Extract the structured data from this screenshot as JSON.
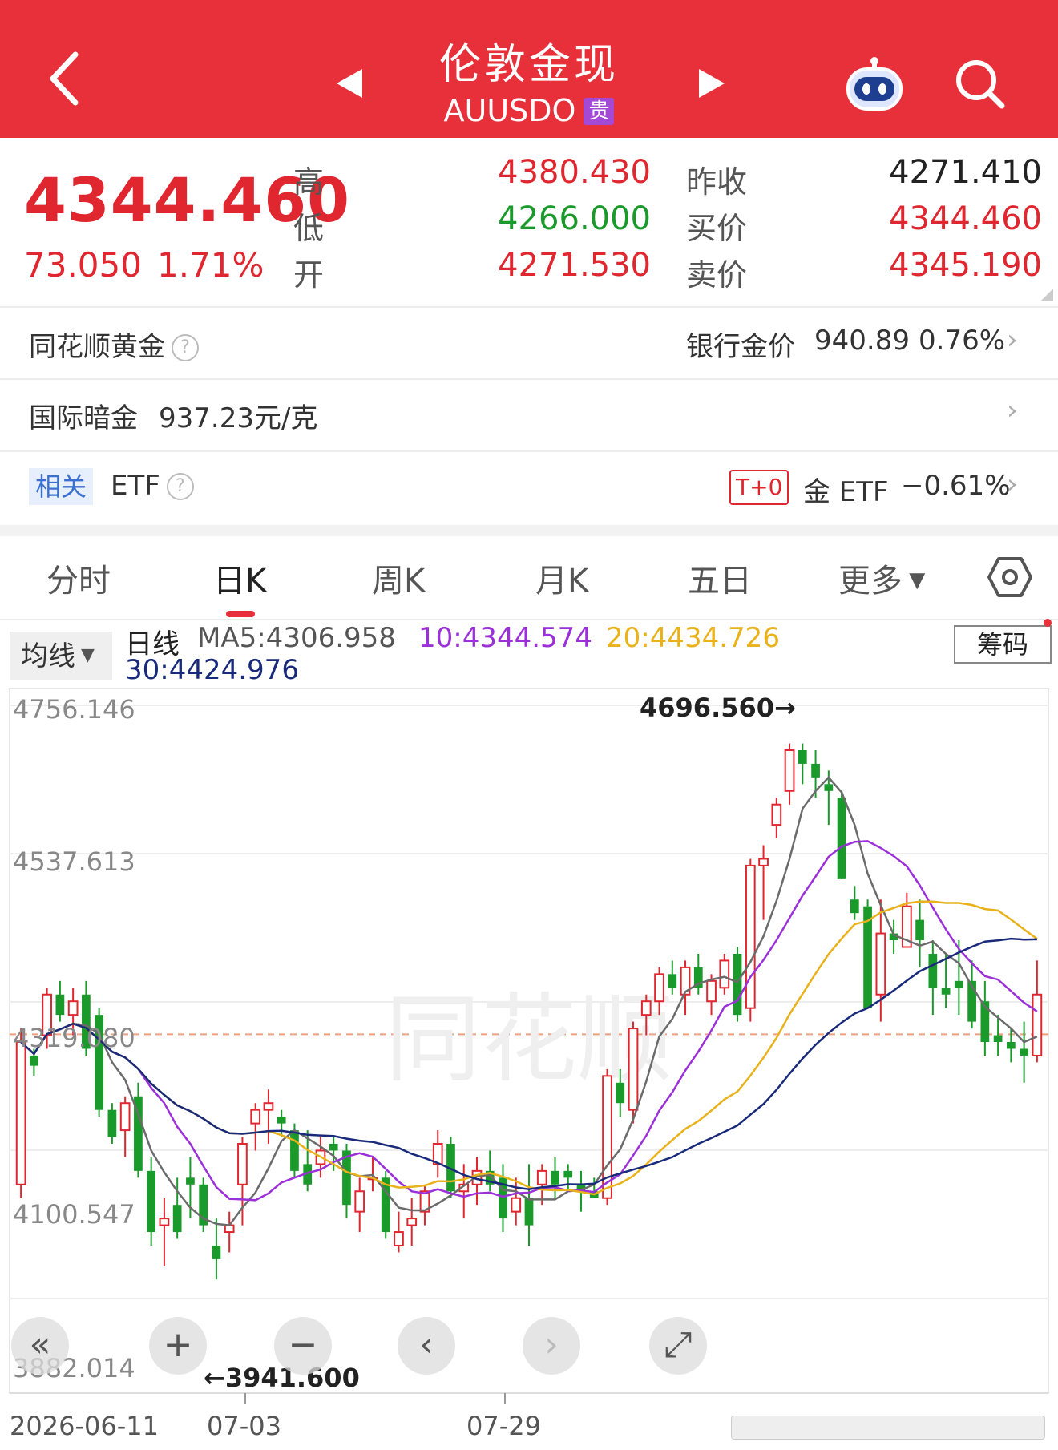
{
  "header": {
    "title": "伦敦金现",
    "subtitle": "AUUSDO",
    "badge": "贵"
  },
  "quote": {
    "price": "4344.460",
    "change": "73.050",
    "change_pct": "1.71%",
    "high_label": "高",
    "high": "4380.430",
    "low_label": "低",
    "low": "4266.000",
    "open_label": "开",
    "open": "4271.530",
    "prev_close_label": "昨收",
    "prev_close": "4271.410",
    "bid_label": "买价",
    "bid": "4344.460",
    "ask_label": "卖价",
    "ask": "4345.190"
  },
  "rows": {
    "ths_gold": "同花顺黄金",
    "bank_gold_label": "银行金价",
    "bank_gold_price": "940.89",
    "bank_gold_pct": "0.76%",
    "dark_gold_label": "国际暗金",
    "dark_gold_value": "937.23元/克",
    "related_tag": "相关",
    "etf_label": "ETF",
    "t0_tag": "T+0",
    "gold_etf_label": "金 ETF",
    "gold_etf_pct": "−0.61%"
  },
  "tabs": [
    "分时",
    "日K",
    "周K",
    "月K",
    "五日",
    "更多"
  ],
  "indicators": {
    "dropdown": "均线",
    "period": "日线",
    "ma5": "MA5:4306.958",
    "ma10": "10:4344.574",
    "ma20": "20:4434.726",
    "ma30": "30:4424.976",
    "chip_button": "筹码"
  },
  "colors": {
    "header": "#e8303a",
    "up": "#e0262f",
    "down": "#1a9a2a",
    "ma5": "#6b6b6b",
    "ma10": "#9b30d9",
    "ma20": "#e9b21a",
    "ma30": "#1a2a7a"
  },
  "icons": [
    "back-icon",
    "prev-arrow-icon",
    "next-arrow-icon",
    "robot-icon",
    "search-icon",
    "help-icon",
    "chevron-right-icon",
    "settings-hexagon-icon"
  ],
  "chart_data": {
    "type": "candlestick",
    "y_ticks": [
      "4756.146",
      "4537.613",
      "4319.080",
      "4100.547",
      "3882.014"
    ],
    "ylim": [
      3882.014,
      4756.146
    ],
    "x_ticks": [
      "2026-06-11",
      "07-03",
      "07-29"
    ],
    "max_label": "4696.560→",
    "min_label": "←3941.600",
    "ref_line": 4271.41,
    "candles": [
      [
        4050,
        4280,
        4030,
        4260
      ],
      [
        4240,
        4250,
        4210,
        4225
      ],
      [
        4270,
        4340,
        4250,
        4330
      ],
      [
        4330,
        4350,
        4290,
        4300
      ],
      [
        4300,
        4340,
        4270,
        4320
      ],
      [
        4330,
        4350,
        4240,
        4250
      ],
      [
        4300,
        4310,
        4150,
        4160
      ],
      [
        4160,
        4170,
        4110,
        4120
      ],
      [
        4130,
        4180,
        4090,
        4170
      ],
      [
        4180,
        4200,
        4060,
        4070
      ],
      [
        4070,
        4090,
        3960,
        3980
      ],
      [
        3990,
        4030,
        3930,
        4000
      ],
      [
        4020,
        4060,
        3970,
        3980
      ],
      [
        4060,
        4090,
        4000,
        4050
      ],
      [
        4050,
        4060,
        3980,
        3990
      ],
      [
        3960,
        4000,
        3910,
        3940
      ],
      [
        3980,
        4010,
        3950,
        3990
      ],
      [
        4050,
        4120,
        3990,
        4110
      ],
      [
        4140,
        4170,
        4100,
        4160
      ],
      [
        4160,
        4190,
        4110,
        4170
      ],
      [
        4150,
        4160,
        4120,
        4140
      ],
      [
        4130,
        4140,
        4060,
        4070
      ],
      [
        4080,
        4130,
        4040,
        4050
      ],
      [
        4080,
        4120,
        4060,
        4100
      ],
      [
        4110,
        4120,
        4070,
        4100
      ],
      [
        4100,
        4110,
        4000,
        4020
      ],
      [
        4010,
        4060,
        3980,
        4040
      ],
      [
        4060,
        4090,
        4040,
        4060
      ],
      [
        4060,
        4070,
        3970,
        3980
      ],
      [
        3960,
        4010,
        3950,
        3980
      ],
      [
        3990,
        4030,
        3960,
        4000
      ],
      [
        4010,
        4050,
        3990,
        4040
      ],
      [
        4080,
        4130,
        4060,
        4110
      ],
      [
        4110,
        4120,
        4030,
        4040
      ],
      [
        4040,
        4080,
        4000,
        4050
      ],
      [
        4050,
        4090,
        4020,
        4070
      ],
      [
        4070,
        4100,
        4040,
        4050
      ],
      [
        4060,
        4080,
        3980,
        4000
      ],
      [
        4010,
        4060,
        3990,
        4030
      ],
      [
        4030,
        4080,
        3960,
        3990
      ],
      [
        4050,
        4080,
        4020,
        4070
      ],
      [
        4070,
        4090,
        4030,
        4050
      ],
      [
        4070,
        4080,
        4040,
        4060
      ],
      [
        4050,
        4070,
        4010,
        4040
      ],
      [
        4040,
        4060,
        4030,
        4030
      ],
      [
        4030,
        4220,
        4020,
        4210
      ],
      [
        4200,
        4220,
        4150,
        4170
      ],
      [
        4160,
        4290,
        4140,
        4280
      ],
      [
        4300,
        4330,
        4270,
        4320
      ],
      [
        4320,
        4370,
        4300,
        4360
      ],
      [
        4360,
        4380,
        4330,
        4340
      ],
      [
        4330,
        4380,
        4300,
        4370
      ],
      [
        4370,
        4390,
        4330,
        4340
      ],
      [
        4320,
        4360,
        4300,
        4350
      ],
      [
        4340,
        4390,
        4330,
        4380
      ],
      [
        4390,
        4400,
        4290,
        4300
      ],
      [
        4310,
        4530,
        4290,
        4520
      ],
      [
        4520,
        4550,
        4440,
        4530
      ],
      [
        4580,
        4620,
        4560,
        4610
      ],
      [
        4630,
        4700,
        4610,
        4690
      ],
      [
        4690,
        4700,
        4640,
        4670
      ],
      [
        4670,
        4690,
        4620,
        4650
      ],
      [
        4640,
        4660,
        4580,
        4630
      ],
      [
        4620,
        4630,
        4500,
        4500
      ],
      [
        4470,
        4490,
        4440,
        4450
      ],
      [
        4460,
        4470,
        4310,
        4310
      ],
      [
        4330,
        4470,
        4290,
        4420
      ],
      [
        4420,
        4440,
        4390,
        4410
      ],
      [
        4400,
        4480,
        4400,
        4460
      ],
      [
        4440,
        4470,
        4370,
        4410
      ],
      [
        4390,
        4410,
        4300,
        4340
      ],
      [
        4340,
        4390,
        4310,
        4330
      ],
      [
        4350,
        4410,
        4300,
        4340
      ],
      [
        4350,
        4380,
        4280,
        4290
      ],
      [
        4320,
        4350,
        4240,
        4260
      ],
      [
        4270,
        4300,
        4240,
        4260
      ],
      [
        4260,
        4280,
        4230,
        4250
      ],
      [
        4250,
        4290,
        4200,
        4240
      ],
      [
        4240,
        4380,
        4230,
        4330
      ]
    ]
  }
}
